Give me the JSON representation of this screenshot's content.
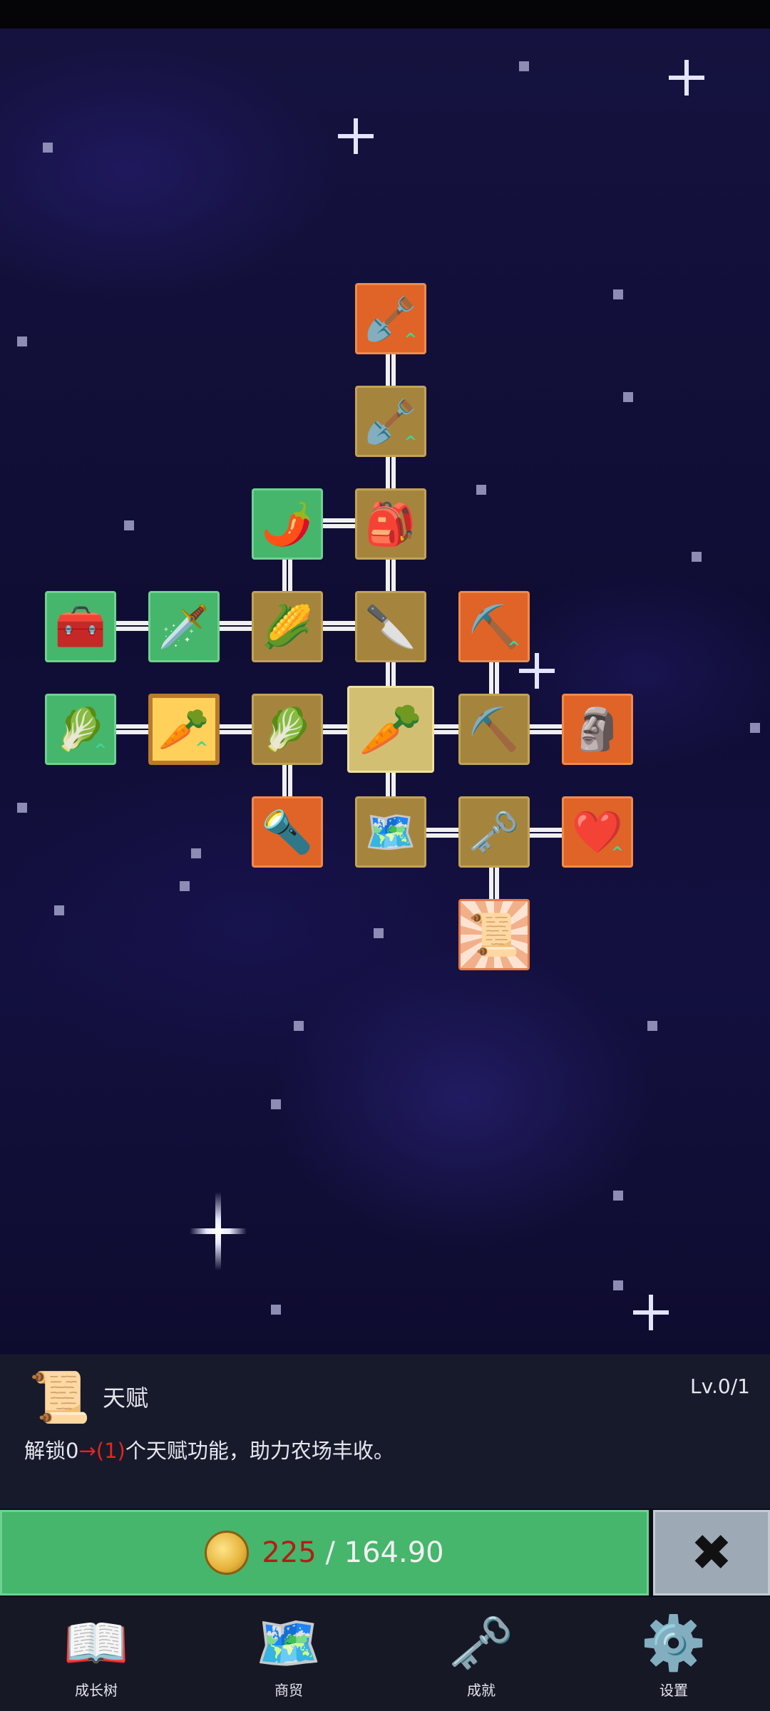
{
  "tree": {
    "nodes": [
      {
        "name": "shovel-upgrade-node",
        "icon": "shovel-icon",
        "glyph": "🪏",
        "upgrade": true
      },
      {
        "name": "shovel-node",
        "icon": "shovel-icon",
        "glyph": "🪏",
        "upgrade": true
      },
      {
        "name": "chili-node",
        "icon": "chili-pepper-icon",
        "glyph": "🌶️"
      },
      {
        "name": "backpack-node",
        "icon": "backpack-icon",
        "glyph": "🎒"
      },
      {
        "name": "chest-node",
        "icon": "chest-icon",
        "glyph": "🧰"
      },
      {
        "name": "sword-node",
        "icon": "sword-icon",
        "glyph": "🗡️"
      },
      {
        "name": "corn-node",
        "icon": "corn-icon",
        "glyph": "🌽"
      },
      {
        "name": "dagger-node",
        "icon": "dagger-icon",
        "glyph": "🔪"
      },
      {
        "name": "pickaxe-upgrade-node",
        "icon": "pickaxe-icon",
        "glyph": "⛏️",
        "upgrade": true
      },
      {
        "name": "cabbage-upgrade-node",
        "icon": "cabbage-icon",
        "glyph": "🥬",
        "upgrade": true
      },
      {
        "name": "carrot-upgrade-node",
        "icon": "carrot-icon",
        "glyph": "🥕",
        "upgrade": true
      },
      {
        "name": "cabbage-node",
        "icon": "cabbage-icon",
        "glyph": "🥬"
      },
      {
        "name": "carrot-center-node",
        "icon": "carrot-icon",
        "glyph": "🥕"
      },
      {
        "name": "pickaxe-node",
        "icon": "pickaxe-icon",
        "glyph": "⛏️"
      },
      {
        "name": "statue-node",
        "icon": "statue-icon",
        "glyph": "🗿"
      },
      {
        "name": "torch-node",
        "icon": "torch-icon",
        "glyph": "🔦"
      },
      {
        "name": "map-node",
        "icon": "map-icon",
        "glyph": "🗺️"
      },
      {
        "name": "key-node",
        "icon": "key-icon",
        "glyph": "🗝️"
      },
      {
        "name": "heart-node",
        "icon": "heart-icon",
        "glyph": "❤️",
        "upgrade": true
      },
      {
        "name": "talent-scroll-node",
        "icon": "scroll-icon",
        "glyph": "📜"
      }
    ]
  },
  "info": {
    "icon": "scroll-icon",
    "icon_glyph": "📜",
    "title": "天赋",
    "level": "Lv.0/1",
    "desc_before": "解锁0",
    "desc_highlight": "→(1)",
    "desc_after": "个天赋功能，助力农场丰收。"
  },
  "purchase": {
    "coin_icon": "gold-coin-icon",
    "have": "225",
    "separator": " / ",
    "need": "164.90",
    "close_glyph": "✖"
  },
  "navbar": {
    "items": [
      {
        "icon": "book-icon",
        "glyph": "📖",
        "label": "成长树"
      },
      {
        "icon": "map-icon",
        "glyph": "🗺️",
        "label": "商贸"
      },
      {
        "icon": "key-icon",
        "glyph": "🗝️",
        "label": "成就"
      },
      {
        "icon": "gear-icon",
        "glyph": "⚙️",
        "label": "设置"
      }
    ]
  },
  "colors": {
    "node_orange": "#e06327",
    "node_brown": "#a5853e",
    "node_green": "#45b66c",
    "buy_button": "#45b66c",
    "close_button": "#9da9b5",
    "highlight_red": "#e2261d"
  },
  "upgrade_marker": "^"
}
